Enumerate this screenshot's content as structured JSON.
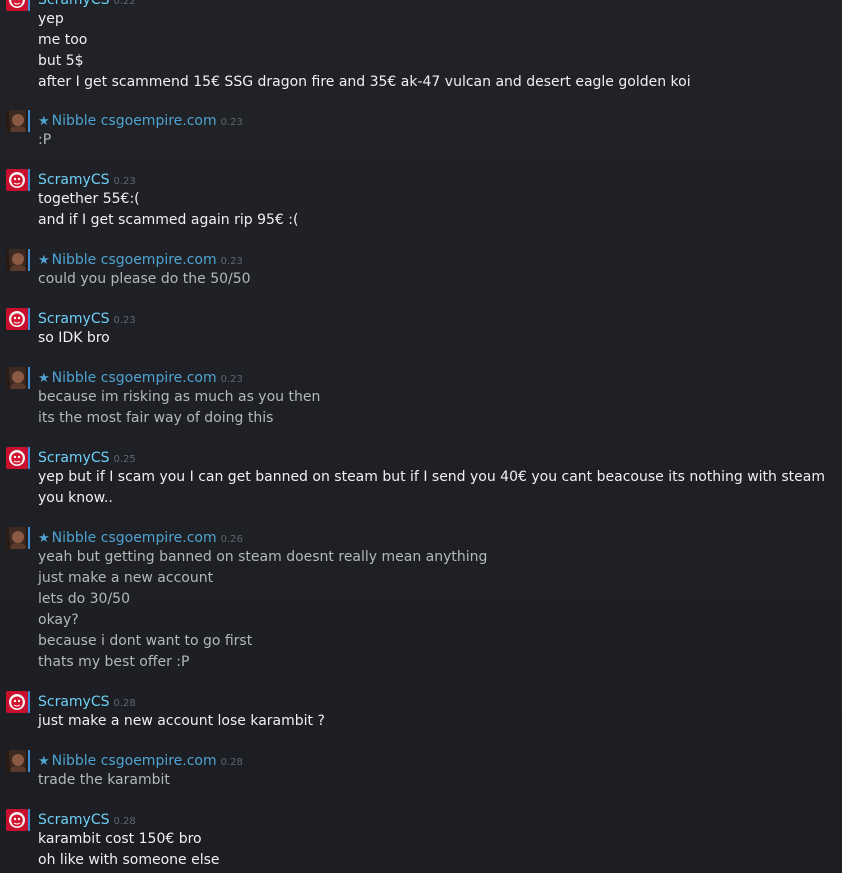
{
  "messages": [
    {
      "sender": "scramy",
      "name": "ScramyCS",
      "time": "0.22",
      "lines": [
        "yep",
        "me too",
        "but 5$",
        "after I get scammend 15€ SSG dragon fire and 35€ ak-47 vulcan and desert eagle golden koi"
      ]
    },
    {
      "sender": "nibble",
      "name": "Nibble csgoempire.com",
      "time": "0.23",
      "lines": [
        ":P"
      ]
    },
    {
      "sender": "scramy",
      "name": "ScramyCS",
      "time": "0.23",
      "lines": [
        "together 55€:(",
        "and if I get scammed again rip 95€ :("
      ]
    },
    {
      "sender": "nibble",
      "name": "Nibble csgoempire.com",
      "time": "0.23",
      "lines": [
        "could you please do the 50/50"
      ]
    },
    {
      "sender": "scramy",
      "name": "ScramyCS",
      "time": "0.23",
      "lines": [
        "so IDK bro"
      ]
    },
    {
      "sender": "nibble",
      "name": "Nibble csgoempire.com",
      "time": "0.23",
      "lines": [
        "because im risking as much as you then",
        "its the most fair way of doing this"
      ]
    },
    {
      "sender": "scramy",
      "name": "ScramyCS",
      "time": "0.25",
      "lines": [
        "yep but if I scam you I can get banned on steam but if I send you 40€ you cant beacouse its nothing with steam",
        "you know.."
      ]
    },
    {
      "sender": "nibble",
      "name": "Nibble csgoempire.com",
      "time": "0.26",
      "lines": [
        "yeah but getting banned on steam doesnt really mean anything",
        "just make a new account",
        "lets do 30/50",
        "okay?",
        "because i dont want to go first",
        "thats my best offer :P"
      ]
    },
    {
      "sender": "scramy",
      "name": "ScramyCS",
      "time": "0.28",
      "lines": [
        "just make a new account lose karambit ?"
      ]
    },
    {
      "sender": "nibble",
      "name": "Nibble csgoempire.com",
      "time": "0.28",
      "lines": [
        "trade the karambit"
      ]
    },
    {
      "sender": "scramy",
      "name": "ScramyCS",
      "time": "0.28",
      "lines": [
        "karambit cost 150€ bro",
        "oh like with someone else"
      ]
    }
  ],
  "star_glyph": "★",
  "colors": {
    "scramy_name": "#6dcff6",
    "nibble_name": "#4fa3d1",
    "timestamp": "#5f6570",
    "background": "#1f2126"
  },
  "icons": {
    "scramy_avatar": "red-lion-avatar",
    "nibble_avatar": "portrait-avatar"
  }
}
